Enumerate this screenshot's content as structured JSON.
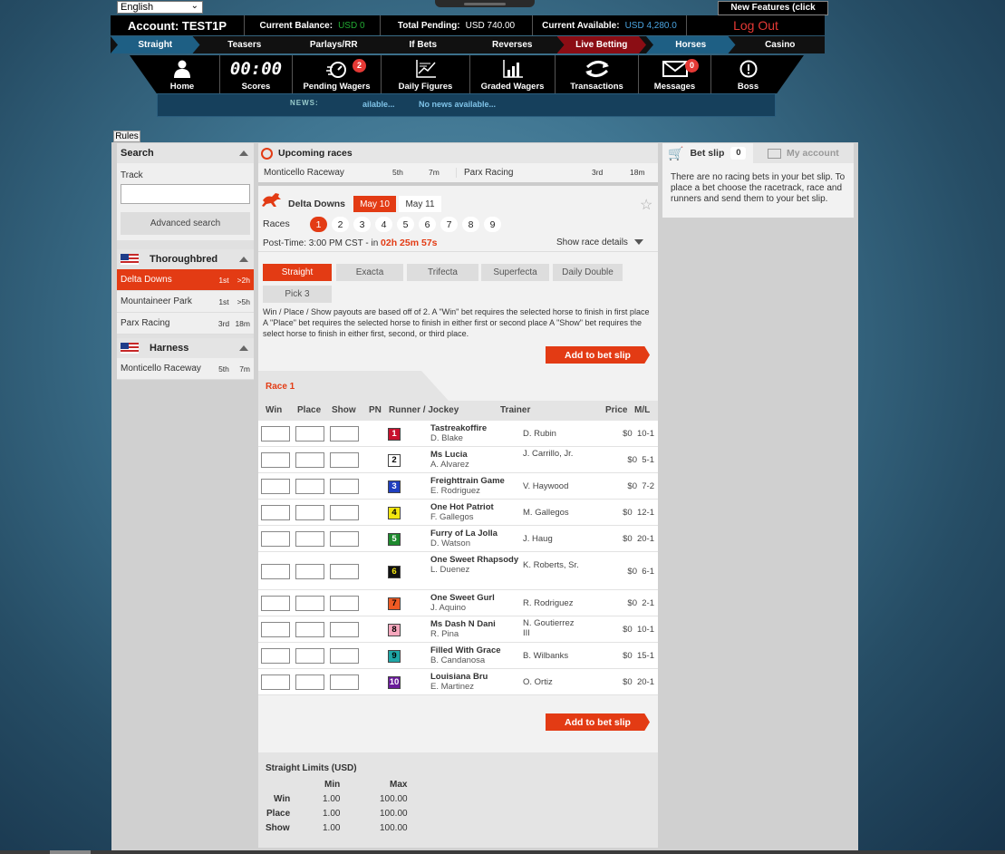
{
  "lang": {
    "value": "English"
  },
  "new_features": "New Features (click here)",
  "account": {
    "name_label": "Account:",
    "name": "TEST1P",
    "balance_label": "Current Balance:",
    "balance": "USD 0",
    "pending_label": "Total Pending:",
    "pending": "USD 740.00",
    "available_label": "Current Available:",
    "available": "USD 4,280.0",
    "logout": "Log Out"
  },
  "nav": [
    "Straight",
    "Teasers",
    "Parlays/RR",
    "If Bets",
    "Reverses",
    "Live Betting",
    "Horses",
    "Casino"
  ],
  "icons": [
    {
      "label": "Home",
      "icon": "home-icon"
    },
    {
      "label": "Scores",
      "icon": "scoreboard-icon",
      "glyph": "00:00"
    },
    {
      "label": "Pending Wagers",
      "icon": "stopwatch-icon",
      "badge": "2"
    },
    {
      "label": "Daily Figures",
      "icon": "chart-icon"
    },
    {
      "label": "Graded Wagers",
      "icon": "bar-chart-icon"
    },
    {
      "label": "Transactions",
      "icon": "exchange-icon"
    },
    {
      "label": "Messages",
      "icon": "envelope-icon",
      "badge": "0"
    },
    {
      "label": "Boss",
      "icon": "alert-icon"
    }
  ],
  "news": {
    "label": "NEWS:",
    "ticker1": "ailable...",
    "ticker2": "No news available..."
  },
  "rules": "Rules",
  "search": {
    "title": "Search",
    "track_label": "Track",
    "track_value": "",
    "advanced": "Advanced search"
  },
  "thoroughbred": {
    "title": "Thoroughbred",
    "tracks": [
      {
        "name": "Delta Downs",
        "race": "1st",
        "time": ">2h"
      },
      {
        "name": "Mountaineer Park",
        "race": "1st",
        "time": ">5h"
      },
      {
        "name": "Parx Racing",
        "race": "3rd",
        "time": "18m"
      }
    ]
  },
  "harness": {
    "title": "Harness",
    "tracks": [
      {
        "name": "Monticello Raceway",
        "race": "5th",
        "time": "7m"
      }
    ]
  },
  "upcoming": {
    "title": "Upcoming races",
    "items": [
      {
        "name": "Monticello Raceway",
        "race": "5th",
        "time": "7m"
      },
      {
        "name": "Parx Racing",
        "race": "3rd",
        "time": "18m"
      }
    ]
  },
  "track": {
    "name": "Delta Downs",
    "dates": [
      "May 10",
      "May 11"
    ],
    "races_label": "Races",
    "races": [
      "1",
      "2",
      "3",
      "4",
      "5",
      "6",
      "7",
      "8",
      "9"
    ],
    "post_time_label": "Post-Time: 3:00 PM CST - in",
    "countdown": "02h 25m 57s",
    "show_details": "Show race details"
  },
  "bet_types": [
    "Straight",
    "Exacta",
    "Trifecta",
    "Superfecta",
    "Daily Double",
    "Pick 3"
  ],
  "description": "Win / Place / Show payouts are based off of 2. A \"Win\" bet requires the selected horse to finish in first place A \"Place\" bet requires the selected horse to finish in either first or second place A \"Show\" bet requires the select horse to finish in either first, second, or third place.",
  "add_to_slip": "Add to bet slip",
  "race_title": "Race 1",
  "columns": {
    "win": "Win",
    "place": "Place",
    "show": "Show",
    "pn": "PN",
    "runner": "Runner / Jockey",
    "trainer": "Trainer",
    "price": "Price",
    "ml": "M/L"
  },
  "runners": [
    {
      "pn": "1",
      "name": "Tastreakoffire",
      "jockey": "D. Blake",
      "trainer": "D. Rubin",
      "price": "$0",
      "ml": "10-1",
      "bg": "#c8102e",
      "fg": "#ffffff"
    },
    {
      "pn": "2",
      "name": "Ms Lucia",
      "jockey": "A. Alvarez",
      "trainer": "J. Carrillo, Jr.",
      "price": "$0",
      "ml": "5-1",
      "bg": "#ffffff",
      "fg": "#000000"
    },
    {
      "pn": "3",
      "name": "Freighttrain Game",
      "jockey": "E. Rodriguez",
      "trainer": "V. Haywood",
      "price": "$0",
      "ml": "7-2",
      "bg": "#1f3fbf",
      "fg": "#ffffff"
    },
    {
      "pn": "4",
      "name": "One Hot Patriot",
      "jockey": "F. Gallegos",
      "trainer": "M. Gallegos",
      "price": "$0",
      "ml": "12-1",
      "bg": "#f2e60f",
      "fg": "#000000"
    },
    {
      "pn": "5",
      "name": "Furry of La Jolla",
      "jockey": "D. Watson",
      "trainer": "J. Haug",
      "price": "$0",
      "ml": "20-1",
      "bg": "#1e8a2e",
      "fg": "#ffffff"
    },
    {
      "pn": "6",
      "name": "One Sweet Rhapsody",
      "jockey": "L. Duenez",
      "trainer": "K. Roberts, Sr.",
      "price": "$0",
      "ml": "6-1",
      "bg": "#111111",
      "fg": "#f2e60f"
    },
    {
      "pn": "7",
      "name": "One Sweet Gurl",
      "jockey": "J. Aquino",
      "trainer": "R. Rodriguez",
      "price": "$0",
      "ml": "2-1",
      "bg": "#ef5a24",
      "fg": "#000000"
    },
    {
      "pn": "8",
      "name": "Ms Dash N Dani",
      "jockey": "R. Pina",
      "trainer": "N. Goutierrez III",
      "price": "$0",
      "ml": "10-1",
      "bg": "#f7a8be",
      "fg": "#000000"
    },
    {
      "pn": "9",
      "name": "Filled With Grace",
      "jockey": "B. Candanosa",
      "trainer": "B. Wilbanks",
      "price": "$0",
      "ml": "15-1",
      "bg": "#1fa6a6",
      "fg": "#000000"
    },
    {
      "pn": "10",
      "name": "Louisiana Bru",
      "jockey": "E. Martinez",
      "trainer": "O. Ortiz",
      "price": "$0",
      "ml": "20-1",
      "bg": "#6a1b9a",
      "fg": "#ffffff"
    }
  ],
  "limits": {
    "title": "Straight Limits (USD)",
    "min": "Min",
    "max": "Max",
    "rows": [
      {
        "label": "Win",
        "min": "1.00",
        "max": "100.00"
      },
      {
        "label": "Place",
        "min": "1.00",
        "max": "100.00"
      },
      {
        "label": "Show",
        "min": "1.00",
        "max": "100.00"
      }
    ]
  },
  "betslip": {
    "title": "Bet slip",
    "count": "0",
    "account": "My account",
    "empty": "There are no racing bets in your bet slip. To place a bet choose the racetrack, race and runners and send them to your bet slip."
  },
  "colors": {
    "accent": "#e33b14",
    "nav_blue": "#1e5f84",
    "nav_red": "#8b0d14",
    "balance_green": "#22aa33",
    "available_blue": "#4aa3df"
  }
}
